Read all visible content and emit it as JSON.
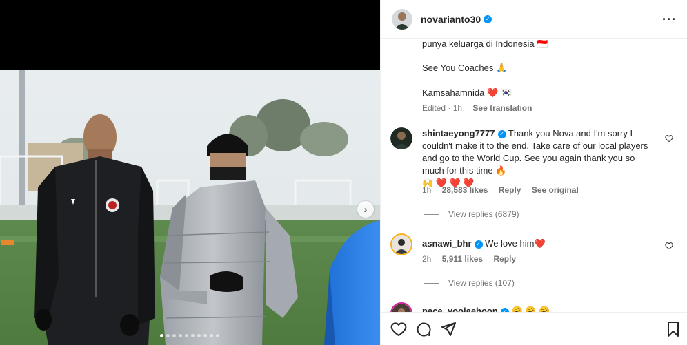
{
  "post": {
    "author": "novarianto30",
    "caption_lines": [
      "punya keluarga di Indonesia 🇮🇩",
      "See You Coaches 🙏",
      "Kamsahamnida ❤️ 🇰🇷"
    ],
    "edited": "Edited",
    "age": "1h",
    "see_translation": "See translation"
  },
  "comments": [
    {
      "user": "shintaeyong7777",
      "text": "Thank you Nova and I'm sorry I couldn't make it to the end. Take care of our local players and go to the World Cup. See you again thank you so much for this time 🔥",
      "text_line2": "🙌 ❤️ ❤️ ❤️",
      "age": "1h",
      "likes": "28,583 likes",
      "reply": "Reply",
      "see_original": "See original",
      "view_replies": "View replies (6879)"
    },
    {
      "user": "asnawi_bhr",
      "text": "We love him❤️",
      "age": "2h",
      "likes": "5,911 likes",
      "reply": "Reply",
      "view_replies": "View replies (107)"
    },
    {
      "user": "pace_yoojaehoon",
      "text": "🤗 🤗 🤗"
    }
  ],
  "carousel": {
    "total": 10,
    "active": 1
  },
  "icons": {
    "more": "more-options-icon",
    "like": "heart-icon",
    "comment": "comment-icon",
    "share": "share-icon",
    "save": "bookmark-icon",
    "next": "chevron-right-icon"
  },
  "colors": {
    "verified": "#0095f6",
    "heart": "#ed4956",
    "muted": "#737373"
  }
}
